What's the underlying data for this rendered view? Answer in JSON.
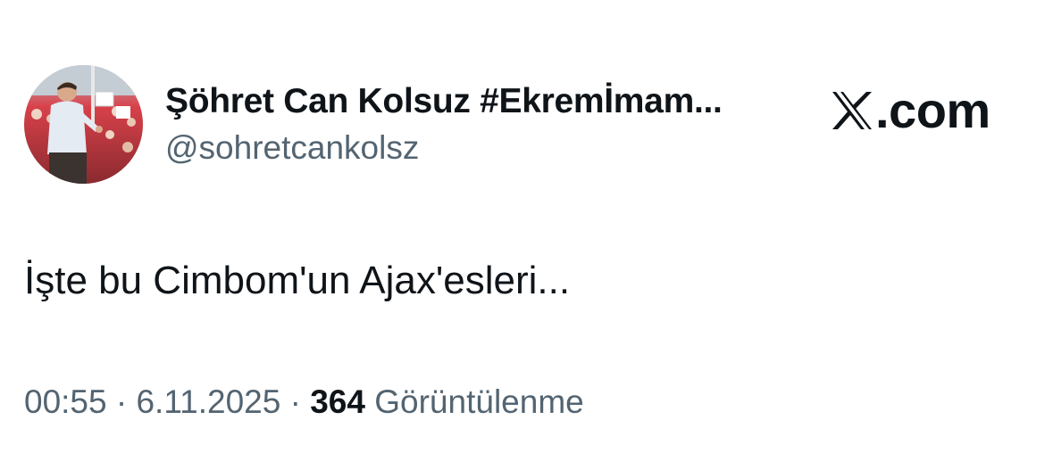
{
  "tweet": {
    "author": {
      "display_name": "Şöhret Can Kolsuz #EkremİmamoğluNeredeyseAdaletOrada",
      "display_name_shown": "Şöhret Can Kolsuz #Ekremİmam...",
      "handle": "@sohretcankolsz",
      "avatar_icon": "profile-photo-speaker-at-rally"
    },
    "brand": {
      "logo_icon": "x-logo-icon",
      "text": ".com"
    },
    "text": "İşte bu Cimbom'un Ajax'esleri...",
    "meta": {
      "time": "00:55",
      "separator": " · ",
      "date": "6.11.2025",
      "views_count": "364",
      "views_label": "Görüntülenme"
    }
  },
  "colors": {
    "primary_text": "#0f1419",
    "secondary_text": "#536471",
    "background": "#ffffff"
  }
}
